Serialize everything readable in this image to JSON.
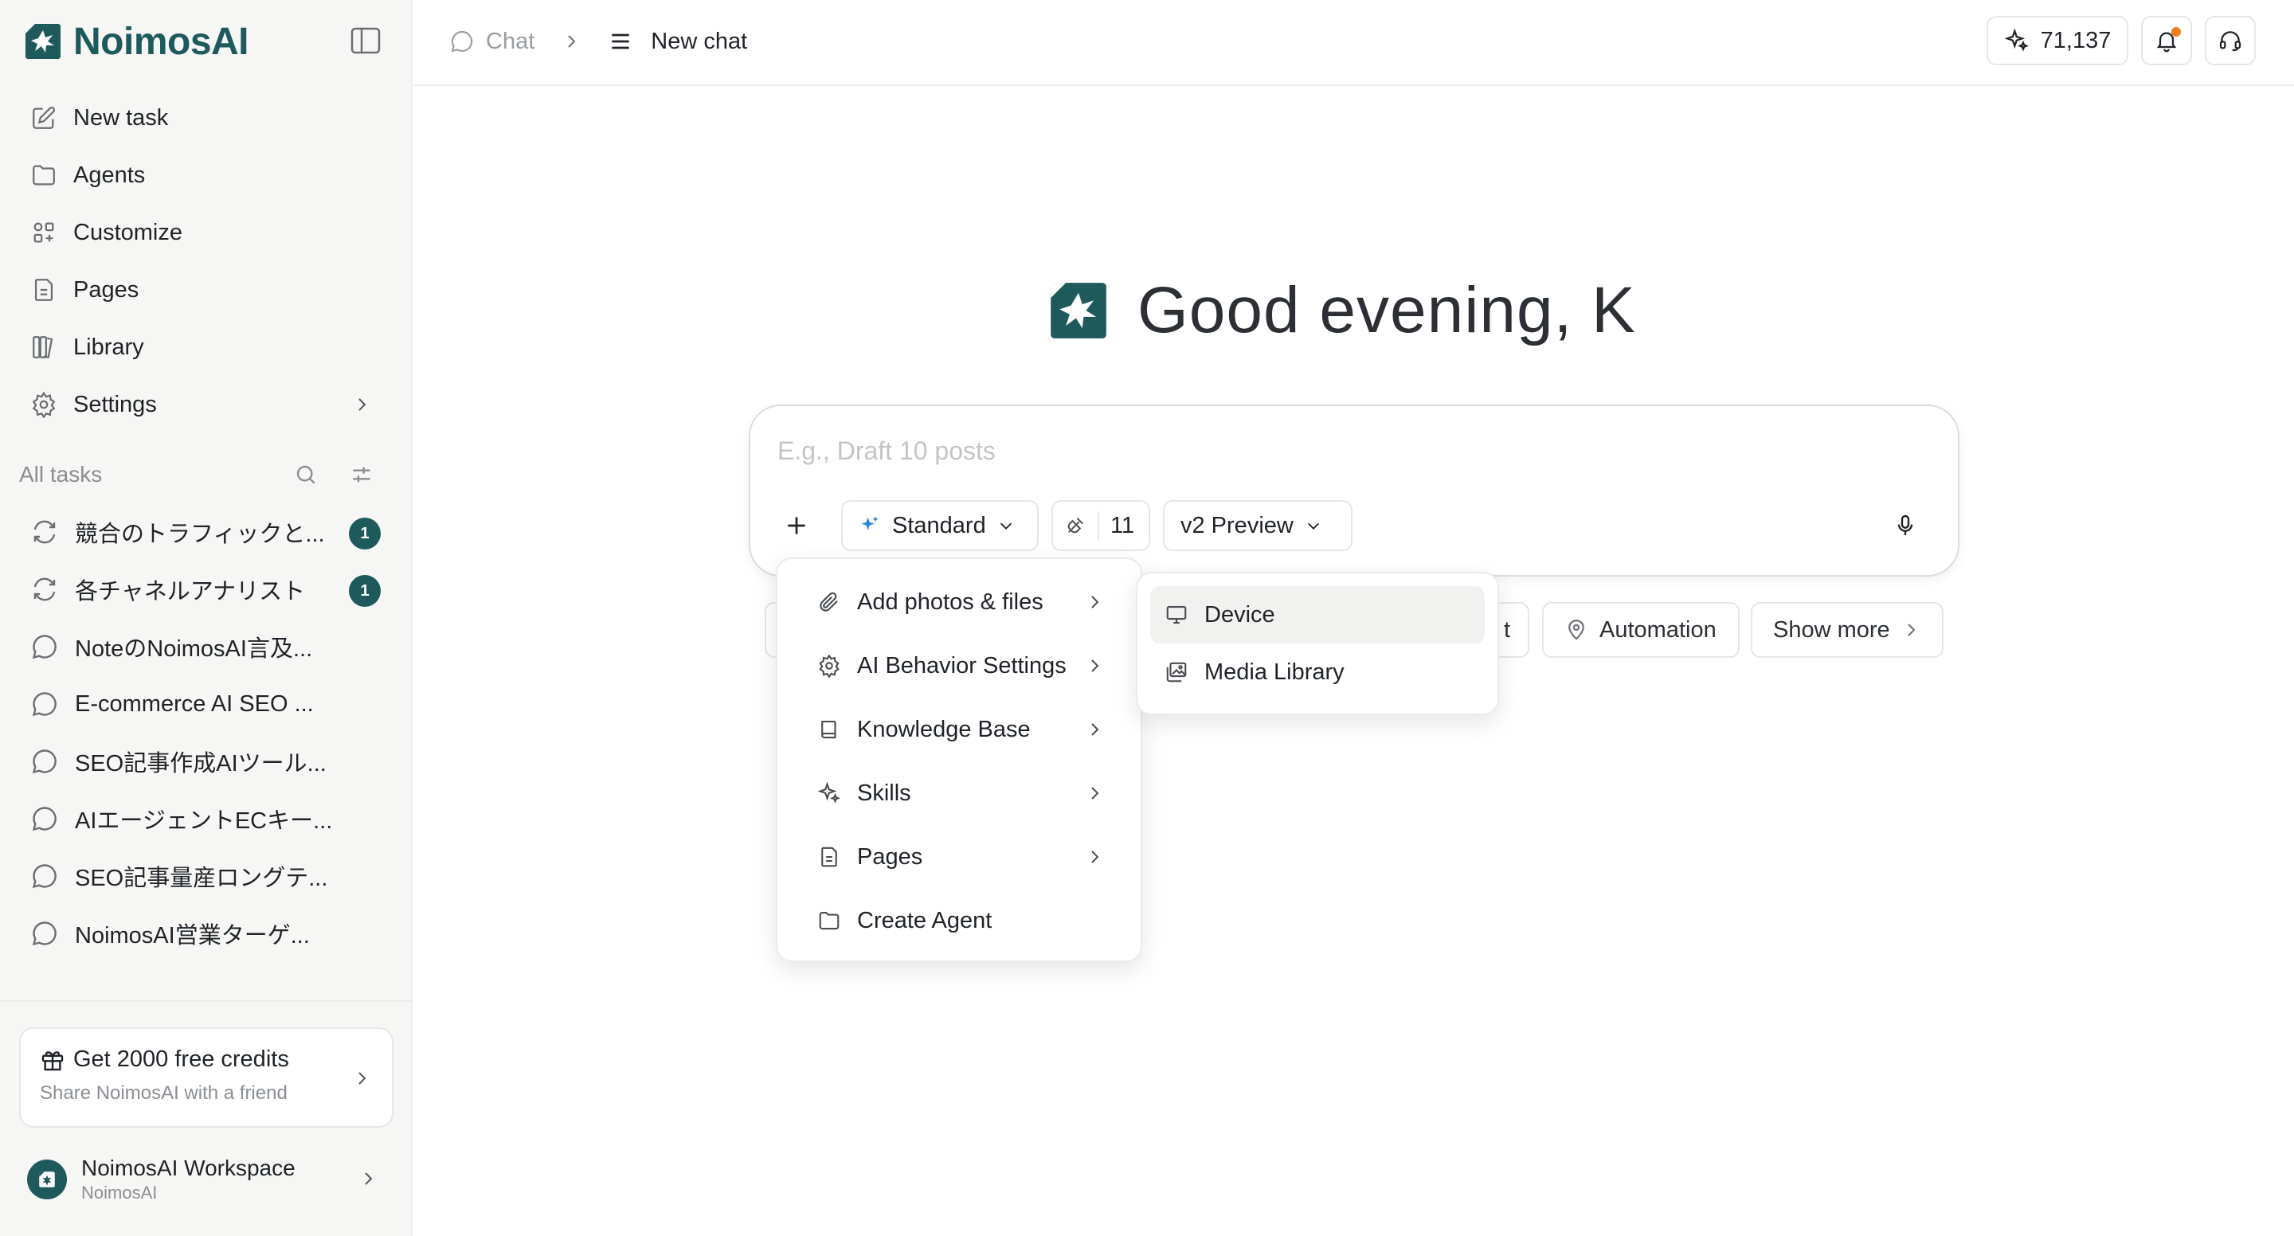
{
  "brand": {
    "name": "NoimosAI",
    "accent": "#1e5a5c"
  },
  "sidebar": {
    "nav": [
      {
        "label": "New task",
        "icon": "edit-icon"
      },
      {
        "label": "Agents",
        "icon": "folder-icon"
      },
      {
        "label": "Customize",
        "icon": "grid-icon"
      },
      {
        "label": "Pages",
        "icon": "document-icon"
      },
      {
        "label": "Library",
        "icon": "library-icon"
      },
      {
        "label": "Settings",
        "icon": "gear-icon"
      }
    ],
    "tasks_heading": "All tasks",
    "tasks": [
      {
        "label": "競合のトラフィックと...",
        "icon": "sync-icon",
        "badge": "1"
      },
      {
        "label": "各チャネルアナリスト",
        "icon": "sync-icon",
        "badge": "1"
      },
      {
        "label": "NoteのNoimosAI言及...",
        "icon": "chat-bubble-icon"
      },
      {
        "label": "E-commerce AI SEO ...",
        "icon": "chat-bubble-icon"
      },
      {
        "label": "SEO記事作成AIツール...",
        "icon": "chat-bubble-icon"
      },
      {
        "label": "AIエージェントECキー...",
        "icon": "chat-bubble-icon"
      },
      {
        "label": "SEO記事量産ロングテ...",
        "icon": "chat-bubble-icon"
      },
      {
        "label": "NoimosAI営業ターゲ...",
        "icon": "chat-bubble-icon"
      }
    ],
    "promo": {
      "title": "Get 2000 free credits",
      "subtitle": "Share NoimosAI with a friend"
    },
    "workspace": {
      "name": "NoimosAI Workspace",
      "sub": "NoimosAI"
    }
  },
  "topbar": {
    "breadcrumb_root": "Chat",
    "breadcrumb_current": "New chat",
    "credits": "71,137",
    "notification_dot_color": "#f07d18"
  },
  "main": {
    "greeting": "Good evening, K",
    "composer": {
      "placeholder": "E.g., Draft 10 posts",
      "mode": "Standard",
      "tools_count": "11",
      "model": "v2 Preview"
    },
    "chips": {
      "behind_fragment": "t",
      "automation": "Automation",
      "show_more": "Show more"
    }
  },
  "plus_menu": {
    "items": [
      {
        "label": "Add photos & files",
        "icon": "paperclip-icon",
        "has_submenu": true
      },
      {
        "label": "AI Behavior Settings",
        "icon": "gear-icon",
        "has_submenu": true
      },
      {
        "label": "Knowledge Base",
        "icon": "book-icon",
        "has_submenu": true
      },
      {
        "label": "Skills",
        "icon": "sparkle-icon",
        "has_submenu": true
      },
      {
        "label": "Pages",
        "icon": "document-icon",
        "has_submenu": true
      },
      {
        "label": "Create Agent",
        "icon": "folder-icon",
        "has_submenu": false
      }
    ]
  },
  "files_submenu": {
    "items": [
      {
        "label": "Device",
        "icon": "monitor-icon",
        "highlighted": true
      },
      {
        "label": "Media Library",
        "icon": "image-gallery-icon",
        "highlighted": false
      }
    ]
  }
}
